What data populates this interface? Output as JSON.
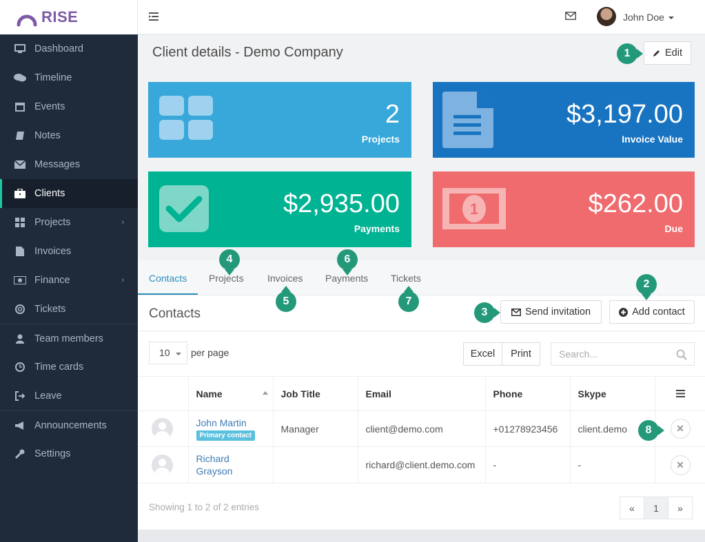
{
  "app": {
    "name": "RISE",
    "brand_color": "#7d5aa6"
  },
  "sidebar": {
    "items": [
      {
        "label": "Dashboard",
        "icon": "desktop-icon"
      },
      {
        "label": "Timeline",
        "icon": "comments-icon"
      },
      {
        "label": "Events",
        "icon": "calendar-icon"
      },
      {
        "label": "Notes",
        "icon": "book-icon"
      },
      {
        "label": "Messages",
        "icon": "envelope-icon"
      },
      {
        "label": "Clients",
        "icon": "briefcase-icon",
        "active": true
      },
      {
        "label": "Projects",
        "icon": "th-large-icon",
        "has_submenu": true
      },
      {
        "label": "Invoices",
        "icon": "file-icon"
      },
      {
        "label": "Finance",
        "icon": "money-icon",
        "has_submenu": true
      },
      {
        "label": "Tickets",
        "icon": "life-ring-icon"
      },
      {
        "label": "Team members",
        "icon": "user-icon"
      },
      {
        "label": "Time cards",
        "icon": "clock-icon"
      },
      {
        "label": "Leave",
        "icon": "sign-out-icon"
      },
      {
        "label": "Announcements",
        "icon": "bullhorn-icon"
      },
      {
        "label": "Settings",
        "icon": "wrench-icon"
      }
    ],
    "chevron": "›"
  },
  "topbar": {
    "user_name": "John Doe"
  },
  "page": {
    "title": "Client details - Demo Company",
    "edit_label": "Edit"
  },
  "stats": [
    {
      "value": "2",
      "label": "Projects",
      "color": "#38a7d9"
    },
    {
      "value": "$3,197.00",
      "label": "Invoice Value",
      "color": "#1873c1"
    },
    {
      "value": "$2,935.00",
      "label": "Payments",
      "color": "#00b393"
    },
    {
      "value": "$262.00",
      "label": "Due",
      "color": "#f06b6e"
    }
  ],
  "tabs": [
    "Contacts",
    "Projects",
    "Invoices",
    "Payments",
    "Tickets"
  ],
  "contacts": {
    "title": "Contacts",
    "send_invitation": "Send invitation",
    "add_contact": "Add contact",
    "page_size": "10",
    "per_page": "per page",
    "excel": "Excel",
    "print": "Print",
    "search_placeholder": "Search...",
    "columns": [
      "Name",
      "Job Title",
      "Email",
      "Phone",
      "Skype"
    ],
    "rows": [
      {
        "name": "John Martin",
        "badge": "Primary contact",
        "job_title": "Manager",
        "email": "client@demo.com",
        "phone": "+01278923456",
        "skype": "client.demo"
      },
      {
        "name": "Richard Grayson",
        "badge": "",
        "job_title": "",
        "email": "richard@client.demo.com",
        "phone": "-",
        "skype": "-"
      }
    ],
    "showing": "Showing 1 to 2 of 2 entries",
    "pager": {
      "prev": "«",
      "current": "1",
      "next": "»"
    }
  },
  "callouts": [
    "1",
    "2",
    "3",
    "4",
    "5",
    "6",
    "7",
    "8"
  ]
}
